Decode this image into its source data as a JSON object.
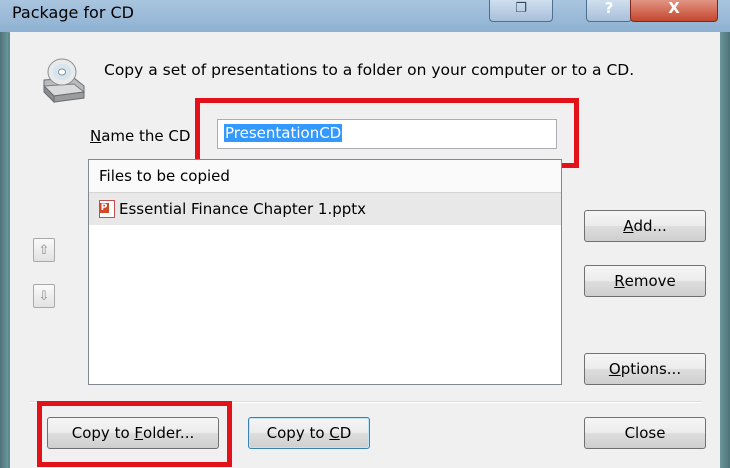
{
  "window": {
    "title": "Package for CD",
    "controls": {
      "restore_glyph": "❐",
      "help_glyph": "?",
      "close_glyph": "X"
    }
  },
  "description": "Copy a set of presentations to a folder on your computer or to a CD.",
  "name_field": {
    "label_underlined": "N",
    "label_rest": "ame the CD",
    "value": "PresentationCD"
  },
  "file_list": {
    "header": "Files to be copied",
    "files": [
      {
        "name": "Essential Finance Chapter 1.pptx",
        "icon": "pptx-file-icon"
      }
    ]
  },
  "order_buttons": {
    "up_glyph": "⇧",
    "down_glyph": "⇩"
  },
  "buttons": {
    "add": {
      "underlined": "A",
      "rest": "dd..."
    },
    "remove": {
      "underlined": "R",
      "rest": "emove"
    },
    "options": {
      "underlined": "O",
      "rest": "ptions..."
    },
    "copy_to_folder": {
      "before": "Copy to ",
      "underlined": "F",
      "rest": "older..."
    },
    "copy_to_cd": {
      "before": "Copy to ",
      "underlined": "C",
      "rest": "D"
    },
    "close": {
      "label": "Close"
    }
  },
  "colors": {
    "highlight_box": "#e3121a",
    "selection": "#3399ff",
    "dialog_bg": "#f0f0f0"
  }
}
